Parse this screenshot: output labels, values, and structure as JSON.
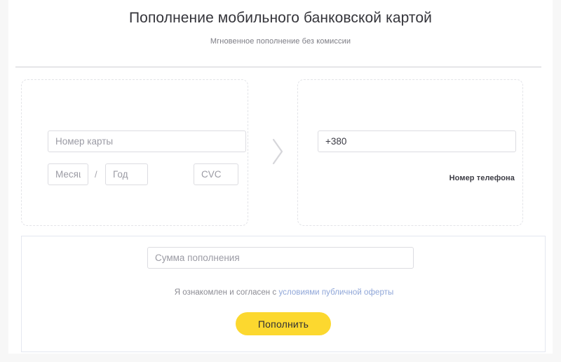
{
  "header": {
    "title": "Пополнение мобильного банковской картой",
    "subtitle": "Мгновенное пополнение без комиссии"
  },
  "card_panel": {
    "card_number_placeholder": "Номер карты",
    "card_number_value": "",
    "month_placeholder": "Месяц",
    "month_value": "",
    "separator": "/",
    "year_placeholder": "Год",
    "year_value": "",
    "cvc_placeholder": "CVC",
    "cvc_value": ""
  },
  "phone_panel": {
    "phone_value": "+380",
    "phone_placeholder": "+380",
    "phone_label": "Номер телефона"
  },
  "separator_icon": "chevron-right-icon",
  "bottom": {
    "amount_placeholder": "Сумма пополнения",
    "amount_value": "",
    "consent_prefix": "Я ознакомлен и согласен с ",
    "consent_link": "условиями публичной оферты",
    "submit_label": "Пополнить"
  },
  "colors": {
    "page_background": "#f7f7f7",
    "card_background": "#ffffff",
    "title_text": "#34343a",
    "subtitle_text": "#7c7c84",
    "divider": "#cfcfd4",
    "panel_dashed_border": "#e3e4e8",
    "input_border": "#dcdce1",
    "placeholder_text": "#9b9ba4",
    "filled_text": "#3b3b44",
    "label_text": "#3c3c44",
    "consent_text": "#8b8b93",
    "consent_link": "#8fa6d8",
    "button_background": "#fcd82f",
    "button_text": "#2e2e33",
    "bottom_box_border": "#e4e7f0",
    "chevron": "#d6d6da"
  }
}
